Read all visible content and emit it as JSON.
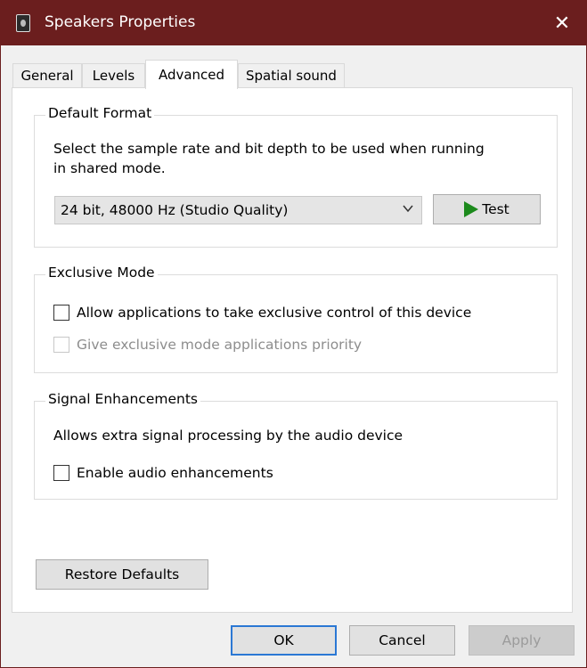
{
  "window": {
    "title": "Speakers Properties",
    "close_glyph": "✕"
  },
  "tabs": [
    {
      "label": "General"
    },
    {
      "label": "Levels"
    },
    {
      "label": "Advanced"
    },
    {
      "label": "Spatial sound"
    }
  ],
  "default_format": {
    "legend": "Default Format",
    "description_line1": "Select the sample rate and bit depth to be used when running",
    "description_line2": "in shared mode.",
    "selected_format": "24 bit, 48000 Hz (Studio Quality)",
    "test_label": "Test"
  },
  "exclusive_mode": {
    "legend": "Exclusive Mode",
    "allow_label": "Allow applications to take exclusive control of this device",
    "priority_label": "Give exclusive mode applications priority"
  },
  "signal_enhancements": {
    "legend": "Signal Enhancements",
    "description": "Allows extra signal processing by the audio device",
    "enable_label": "Enable audio enhancements"
  },
  "restore_defaults_label": "Restore Defaults",
  "footer": {
    "ok_label": "OK",
    "cancel_label": "Cancel",
    "apply_label": "Apply"
  },
  "colors": {
    "titlebar": "#6b1e1e",
    "play_icon": "#1c8a1c",
    "default_button_border": "#2b78d4"
  }
}
